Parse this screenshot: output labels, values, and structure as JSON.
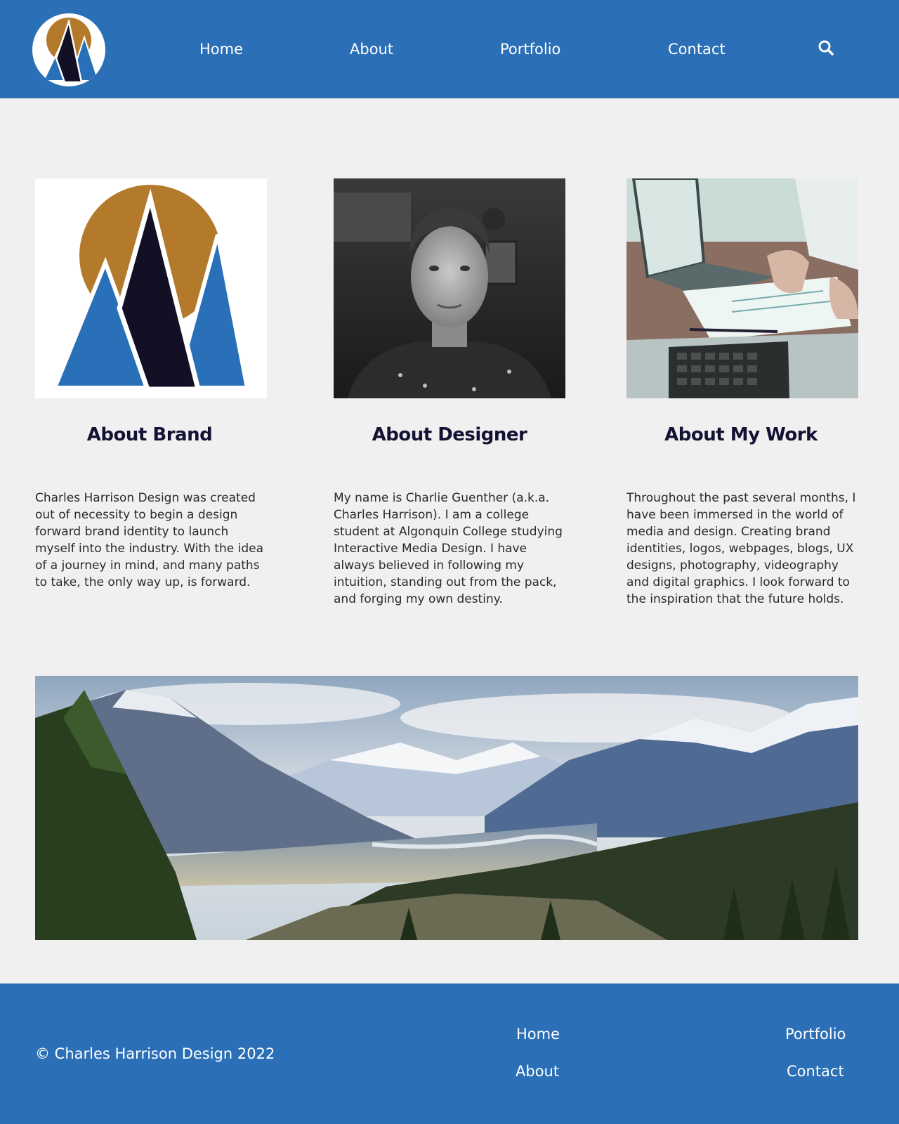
{
  "nav": {
    "items": [
      {
        "label": "Home"
      },
      {
        "label": "About"
      },
      {
        "label": "Portfolio"
      },
      {
        "label": "Contact"
      }
    ]
  },
  "cards": [
    {
      "title": "About Brand",
      "text": "Charles Harrison Design was created out of necessity to begin a design forward brand identity to launch myself into the industry. With the idea of a journey in mind, and many paths to take,  the only way up, is forward."
    },
    {
      "title": "About Designer",
      "text": "My name is Charlie Guenther (a.k.a. Charles Harrison). I am a college student at Algonquin College studying Interactive Media Design. I have always believed in following my intuition, standing out from the pack, and forging my own destiny."
    },
    {
      "title": "About My Work",
      "text": "Throughout the past several months, I have been immersed in the world of media and design. Creating brand identities, logos, webpages, blogs, UX designs, photography, videography and digital graphics. I look forward to the inspiration that the future holds."
    }
  ],
  "footer": {
    "copyright": "© Charles Harrison Design 2022",
    "links": [
      {
        "label": "Home"
      },
      {
        "label": "Portfolio"
      },
      {
        "label": "About"
      },
      {
        "label": "Contact"
      }
    ]
  },
  "colors": {
    "header_bg": "#2b6fb6",
    "page_bg": "#f0f0f0",
    "title_color": "#141233",
    "logo_gold": "#b47a2c",
    "logo_blue": "#2a70b8",
    "logo_dark": "#130f24"
  },
  "icons": {
    "search": "search-icon",
    "logo": "mountain-logo-icon"
  }
}
